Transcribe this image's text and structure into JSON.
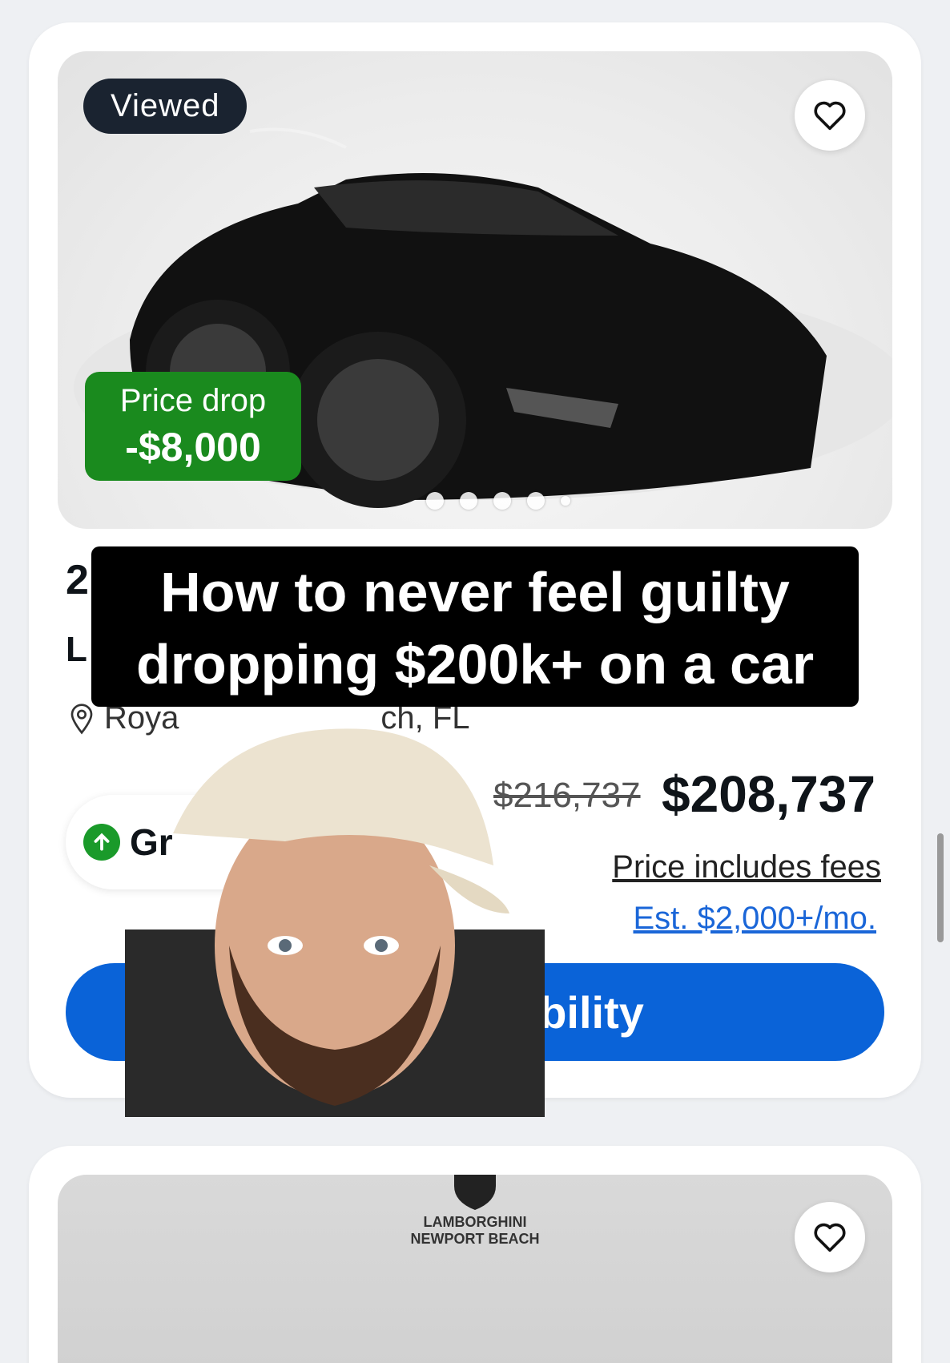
{
  "listing": {
    "viewed_label": "Viewed",
    "price_drop_label": "Price drop",
    "price_drop_amount": "-$8,000",
    "title_year_partial": "2",
    "title_make_partial": "L",
    "location_partial": "Roya",
    "location_suffix": "ch, FL",
    "deal_rating_partial": "Gr",
    "original_price": "$216,737",
    "price": "$208,737",
    "fees_note": "Price includes fees",
    "monthly_estimate": "Est. $2,000+/mo.",
    "cta_partial": "ability",
    "photo_count_dots": 5
  },
  "next_listing": {
    "dealer_name_line1": "LAMBORGHINI",
    "dealer_name_line2": "NEWPORT BEACH"
  },
  "caption": {
    "line1": "How to never feel guilty",
    "line2": "dropping $200k+ on a car"
  },
  "colors": {
    "price_drop_green": "#1a8a1e",
    "cta_blue": "#0a63d8",
    "link_blue": "#1a66d8",
    "badge_dark": "#1a2330"
  }
}
